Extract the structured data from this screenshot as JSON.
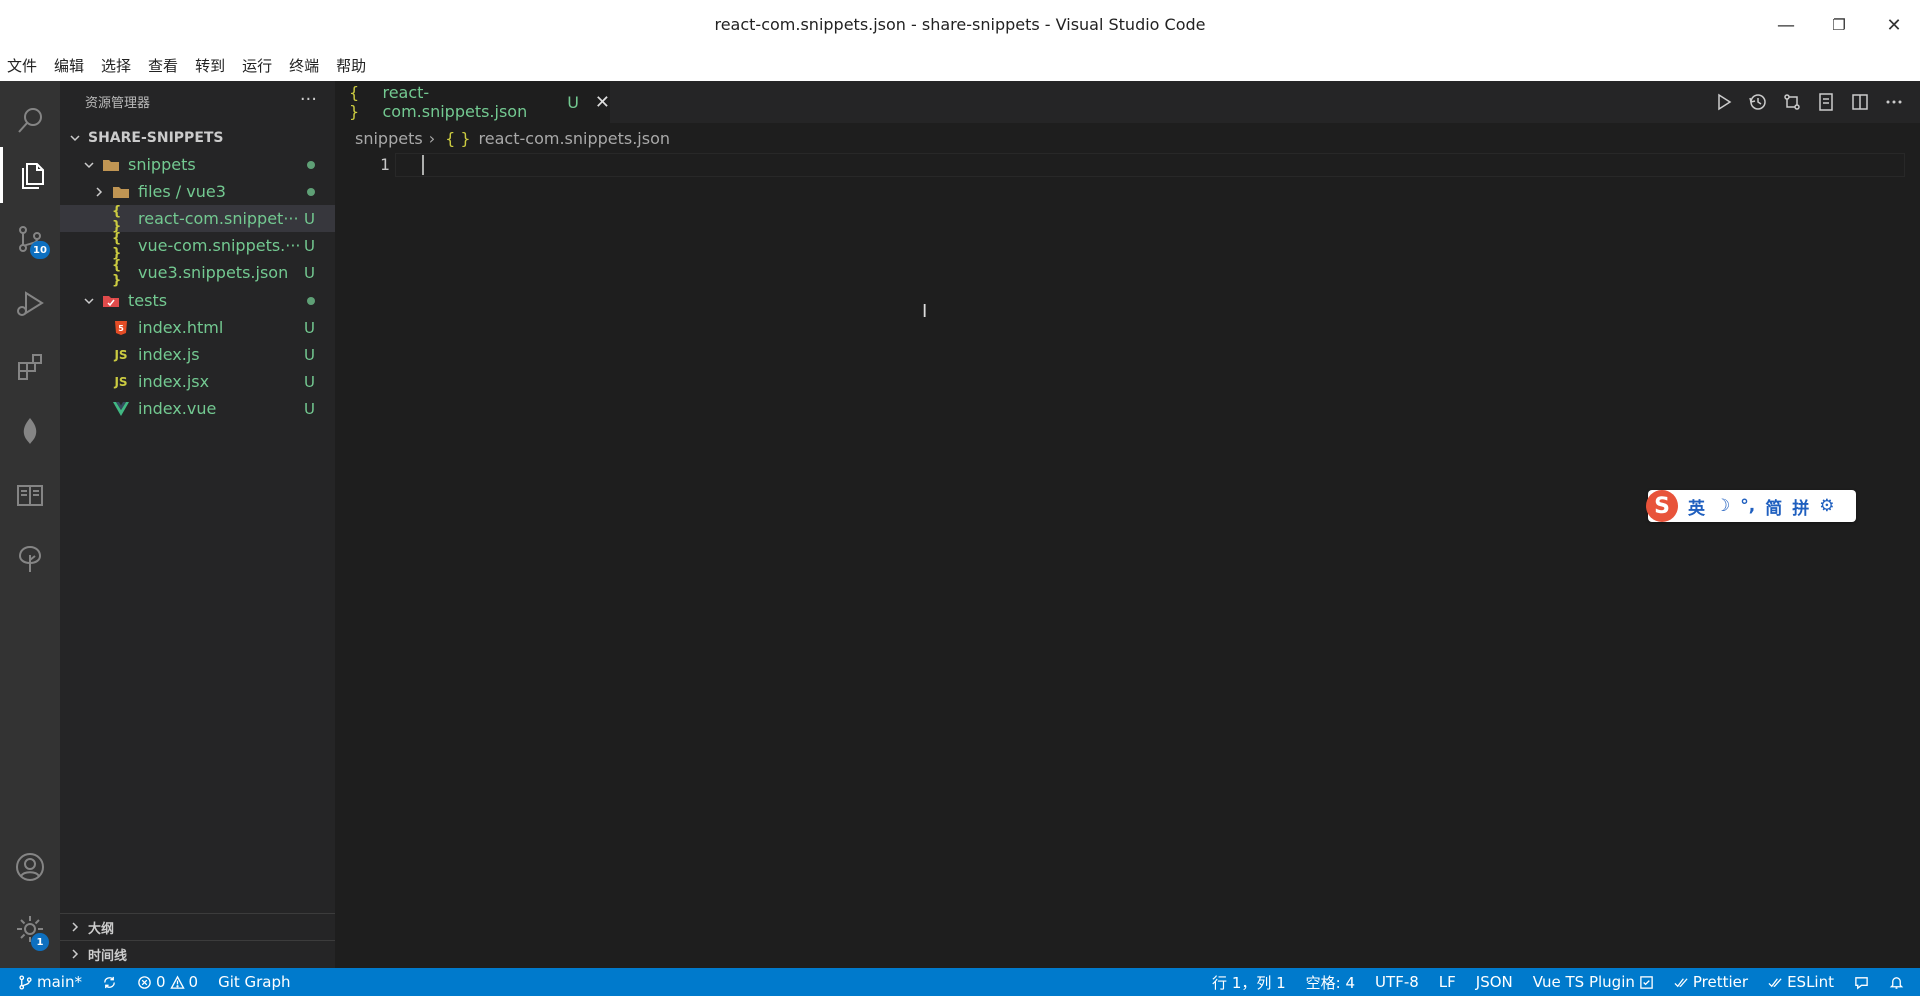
{
  "window": {
    "title": "react-com.snippets.json - share-snippets - Visual Studio Code",
    "minimize": "—",
    "restore": "❐",
    "close": "✕"
  },
  "menu": [
    "文件",
    "编辑",
    "选择",
    "查看",
    "转到",
    "运行",
    "终端",
    "帮助"
  ],
  "activity": {
    "scm_badge": "10",
    "settings_badge": "1"
  },
  "sidebar": {
    "title": "资源管理器",
    "more": "···",
    "root": "SHARE-SNIPPETS",
    "items": [
      {
        "label": "snippets",
        "type": "folder",
        "status": "dot"
      },
      {
        "label": "files / vue3",
        "type": "folder",
        "status": "dot"
      },
      {
        "label": "react-com.snippet···",
        "type": "json",
        "status": "U"
      },
      {
        "label": "vue-com.snippets.···",
        "type": "json",
        "status": "U"
      },
      {
        "label": "vue3.snippets.json",
        "type": "json",
        "status": "U"
      },
      {
        "label": "tests",
        "type": "folder",
        "status": "dot"
      },
      {
        "label": "index.html",
        "type": "html",
        "status": "U"
      },
      {
        "label": "index.js",
        "type": "js",
        "status": "U"
      },
      {
        "label": "index.jsx",
        "type": "js",
        "status": "U"
      },
      {
        "label": "index.vue",
        "type": "vue",
        "status": "U"
      }
    ],
    "outline": "大纲",
    "timeline": "时间线"
  },
  "editor": {
    "tab_label": "react-com.snippets.json",
    "tab_status": "U",
    "tab_braces": "{ }",
    "breadcrumb_folder": "snippets",
    "breadcrumb_file": "react-com.snippets.json",
    "line_number": "1"
  },
  "ime": {
    "logo": "S",
    "items": [
      "英",
      "☽",
      "°,",
      "简",
      "拼",
      "⚙"
    ]
  },
  "statusbar": {
    "branch": "main*",
    "errors": "0",
    "warnings": "0",
    "git_graph": "Git Graph",
    "position": "行 1，列 1",
    "spaces": "空格: 4",
    "encoding": "UTF-8",
    "eol": "LF",
    "language": "JSON",
    "vue_plugin": "Vue TS Plugin",
    "prettier": "Prettier",
    "eslint": "ESLint"
  },
  "colors": {
    "statusbar": "#007acc",
    "untracked": "#73c991",
    "json_braces": "#cbcb41"
  }
}
